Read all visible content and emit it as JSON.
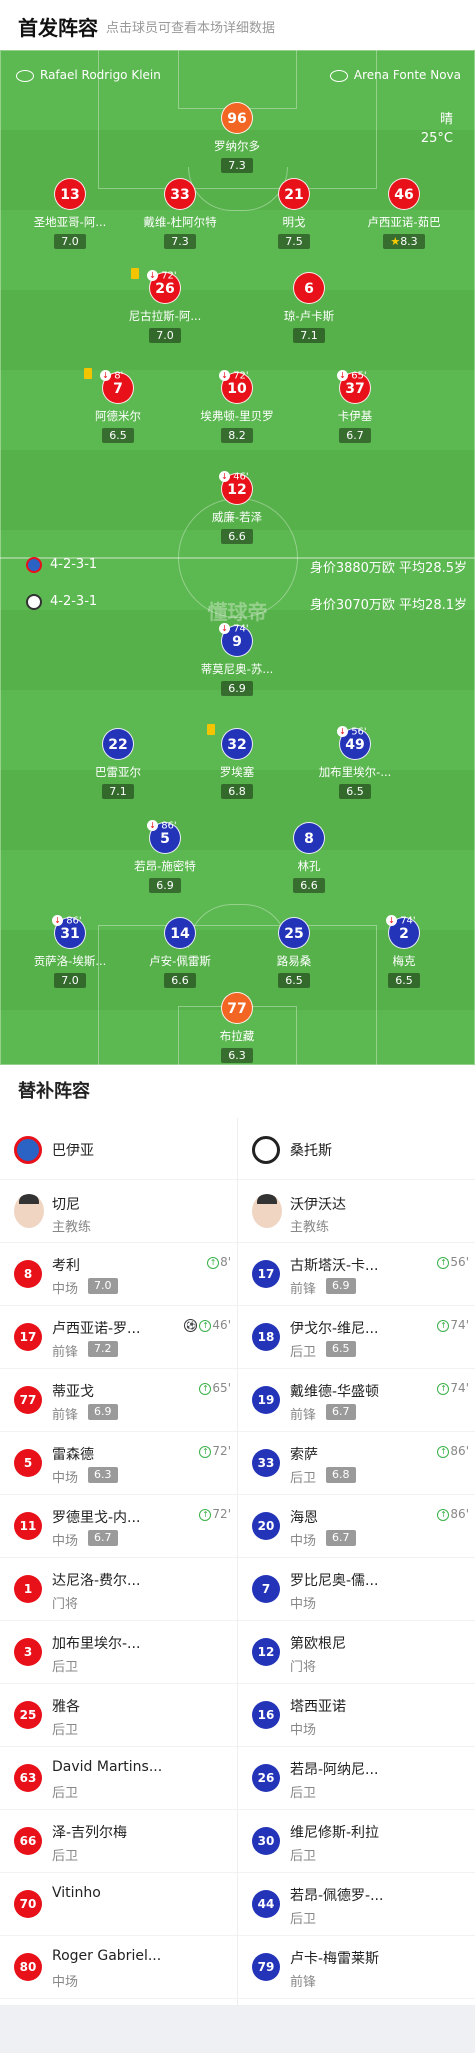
{
  "header": {
    "title": "首发阵容",
    "subtitle": "点击球员可查看本场详细数据"
  },
  "venues": {
    "referee": "Rafael Rodrigo Klein",
    "stadium": "Arena Fonte Nova"
  },
  "weather": {
    "condition": "晴",
    "temp": "25°C"
  },
  "watermark": "懂球帝",
  "home_team": {
    "name": "巴伊亚",
    "formation": "4-2-3-1",
    "value": "身价3880万欧 平均28.5岁",
    "color": "#e8111a"
  },
  "away_team": {
    "name": "桑托斯",
    "formation": "4-2-3-1",
    "value": "身价3070万欧 平均28.1岁",
    "color": "#2334b8"
  },
  "home_players": [
    {
      "num": "96",
      "name": "罗纳尔多",
      "rating": "7.3"
    },
    {
      "num": "13",
      "name": "圣地亚哥-阿...",
      "rating": "7.0"
    },
    {
      "num": "33",
      "name": "戴维-杜阿尔特",
      "rating": "7.3"
    },
    {
      "num": "21",
      "name": "明戈",
      "rating": "7.5"
    },
    {
      "num": "46",
      "name": "卢西亚诺-茹巴",
      "rating": "8.3"
    },
    {
      "num": "26",
      "name": "尼古拉斯-阿...",
      "rating": "7.0",
      "sub": "72'"
    },
    {
      "num": "6",
      "name": "琼-卢卡斯",
      "rating": "7.1"
    },
    {
      "num": "7",
      "name": "阿德米尔",
      "rating": "6.5",
      "sub": "8'"
    },
    {
      "num": "10",
      "name": "埃弗顿-里贝罗",
      "rating": "8.2",
      "sub": "72'"
    },
    {
      "num": "37",
      "name": "卡伊基",
      "rating": "6.7",
      "sub": "65'"
    },
    {
      "num": "12",
      "name": "威廉-若泽",
      "rating": "6.6",
      "sub": "46'"
    }
  ],
  "away_players": [
    {
      "num": "9",
      "name": "蒂莫尼奥-苏...",
      "rating": "6.9",
      "sub": "74'"
    },
    {
      "num": "22",
      "name": "巴雷亚尔",
      "rating": "7.1"
    },
    {
      "num": "32",
      "name": "罗埃塞",
      "rating": "6.8"
    },
    {
      "num": "49",
      "name": "加布里埃尔-...",
      "rating": "6.5",
      "sub": "56'"
    },
    {
      "num": "5",
      "name": "若昂-施密特",
      "rating": "6.9",
      "sub": "86'"
    },
    {
      "num": "8",
      "name": "林孔",
      "rating": "6.6"
    },
    {
      "num": "31",
      "name": "贡萨洛-埃斯...",
      "rating": "7.0",
      "sub": "86'"
    },
    {
      "num": "14",
      "name": "卢安-佩雷斯",
      "rating": "6.6"
    },
    {
      "num": "25",
      "name": "路易桑",
      "rating": "6.5"
    },
    {
      "num": "2",
      "name": "梅克",
      "rating": "6.5",
      "sub": "74'"
    },
    {
      "num": "77",
      "name": "布拉藏",
      "rating": "6.3"
    }
  ],
  "subs_section": {
    "title": "替补阵容"
  },
  "home_coach": {
    "name": "切尼",
    "role": "主教练"
  },
  "away_coach": {
    "name": "沃伊沃达",
    "role": "主教练"
  },
  "home_subs": [
    {
      "num": "8",
      "name": "考利",
      "pos": "中场",
      "rating": "7.0",
      "time": "8'"
    },
    {
      "num": "17",
      "name": "卢西亚诺-罗...",
      "pos": "前锋",
      "rating": "7.2",
      "time": "46'"
    },
    {
      "num": "77",
      "name": "蒂亚戈",
      "pos": "前锋",
      "rating": "6.9",
      "time": "65'"
    },
    {
      "num": "5",
      "name": "雷森德",
      "pos": "中场",
      "rating": "6.3",
      "time": "72'"
    },
    {
      "num": "11",
      "name": "罗德里戈-内...",
      "pos": "中场",
      "rating": "6.7",
      "time": "72'"
    },
    {
      "num": "1",
      "name": "达尼洛-费尔...",
      "pos": "门将"
    },
    {
      "num": "3",
      "name": "加布里埃尔-...",
      "pos": "后卫"
    },
    {
      "num": "25",
      "name": "雅各",
      "pos": "后卫"
    },
    {
      "num": "63",
      "name": "David Martins...",
      "pos": "后卫"
    },
    {
      "num": "66",
      "name": "泽-吉列尔梅",
      "pos": "后卫"
    },
    {
      "num": "70",
      "name": "Vitinho",
      "pos": ""
    },
    {
      "num": "80",
      "name": "Roger Gabriel...",
      "pos": "中场"
    }
  ],
  "away_subs": [
    {
      "num": "17",
      "name": "古斯塔沃-卡...",
      "pos": "前锋",
      "rating": "6.9",
      "time": "56'"
    },
    {
      "num": "18",
      "name": "伊戈尔-维尼...",
      "pos": "后卫",
      "rating": "6.5",
      "time": "74'"
    },
    {
      "num": "19",
      "name": "戴维德-华盛顿",
      "pos": "前锋",
      "rating": "6.7",
      "time": "74'"
    },
    {
      "num": "33",
      "name": "索萨",
      "pos": "后卫",
      "rating": "6.8",
      "time": "86'"
    },
    {
      "num": "20",
      "name": "海恩",
      "pos": "中场",
      "rating": "6.7",
      "time": "86'"
    },
    {
      "num": "7",
      "name": "罗比尼奥-儒...",
      "pos": "中场"
    },
    {
      "num": "12",
      "name": "第欧根尼",
      "pos": "门将"
    },
    {
      "num": "16",
      "name": "塔西亚诺",
      "pos": "中场"
    },
    {
      "num": "26",
      "name": "若昂-阿纳尼...",
      "pos": "后卫"
    },
    {
      "num": "30",
      "name": "维尼修斯-利拉",
      "pos": "后卫"
    },
    {
      "num": "44",
      "name": "若昂-佩德罗-...",
      "pos": "后卫"
    },
    {
      "num": "79",
      "name": "卢卡-梅雷莱斯",
      "pos": "前锋"
    }
  ]
}
